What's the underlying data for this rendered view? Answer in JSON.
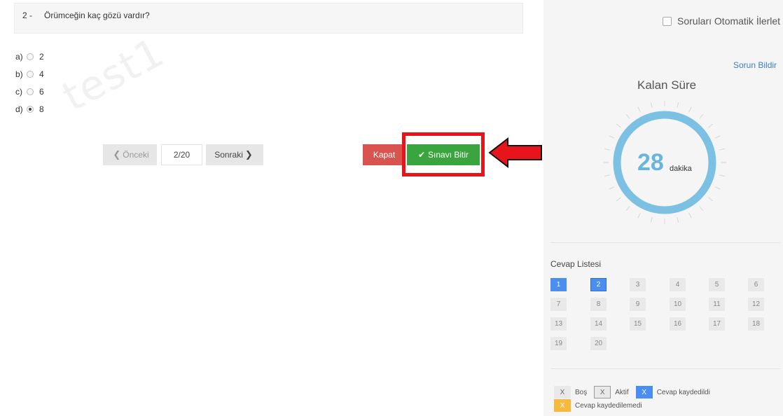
{
  "question": {
    "number": "2 -",
    "text": "Örümceğin kaç gözü vardır?",
    "options": [
      {
        "letter": "a)",
        "value": "2",
        "selected": false
      },
      {
        "letter": "b)",
        "value": "4",
        "selected": false
      },
      {
        "letter": "c)",
        "value": "6",
        "selected": false
      },
      {
        "letter": "d)",
        "value": "8",
        "selected": true
      }
    ]
  },
  "watermark": "test1",
  "navigation": {
    "prev_label": "Önceki",
    "page_indicator": "2/20",
    "next_label": "Sonraki",
    "close_label": "Kapat",
    "finish_label": "Sınavı Bitir"
  },
  "sidebar": {
    "auto_advance_label": "Soruları Otomatik İlerlet",
    "report_label": "Sorun Bildir",
    "timer_title": "Kalan Süre",
    "timer_value": "28",
    "timer_unit": "dakika",
    "answers_title": "Cevap Listesi",
    "answers": [
      {
        "n": "1",
        "state": "saved"
      },
      {
        "n": "2",
        "state": "active-saved"
      },
      {
        "n": "3",
        "state": "blank"
      },
      {
        "n": "4",
        "state": "blank"
      },
      {
        "n": "5",
        "state": "blank"
      },
      {
        "n": "6",
        "state": "blank"
      },
      {
        "n": "7",
        "state": "blank"
      },
      {
        "n": "8",
        "state": "blank"
      },
      {
        "n": "9",
        "state": "blank"
      },
      {
        "n": "10",
        "state": "blank"
      },
      {
        "n": "11",
        "state": "blank"
      },
      {
        "n": "12",
        "state": "blank"
      },
      {
        "n": "13",
        "state": "blank"
      },
      {
        "n": "14",
        "state": "blank"
      },
      {
        "n": "15",
        "state": "blank"
      },
      {
        "n": "16",
        "state": "blank"
      },
      {
        "n": "17",
        "state": "blank"
      },
      {
        "n": "18",
        "state": "blank"
      },
      {
        "n": "19",
        "state": "blank"
      },
      {
        "n": "20",
        "state": "blank"
      }
    ],
    "legend": {
      "box_mark": "X",
      "blank": "Boş",
      "active": "Aktif",
      "saved": "Cevap kaydedildi",
      "failed": "Cevap kaydedilemedi"
    }
  },
  "colors": {
    "accent_blue": "#4a8ef2",
    "timer_ring": "#7cc0e4",
    "finish_green": "#3aa53e",
    "close_red": "#d9534f",
    "highlight_red": "#e8141c",
    "failed_orange": "#f7b93e"
  },
  "icons": [
    "chevron-left-icon",
    "chevron-right-icon",
    "check-icon",
    "red-arrow-icon"
  ]
}
